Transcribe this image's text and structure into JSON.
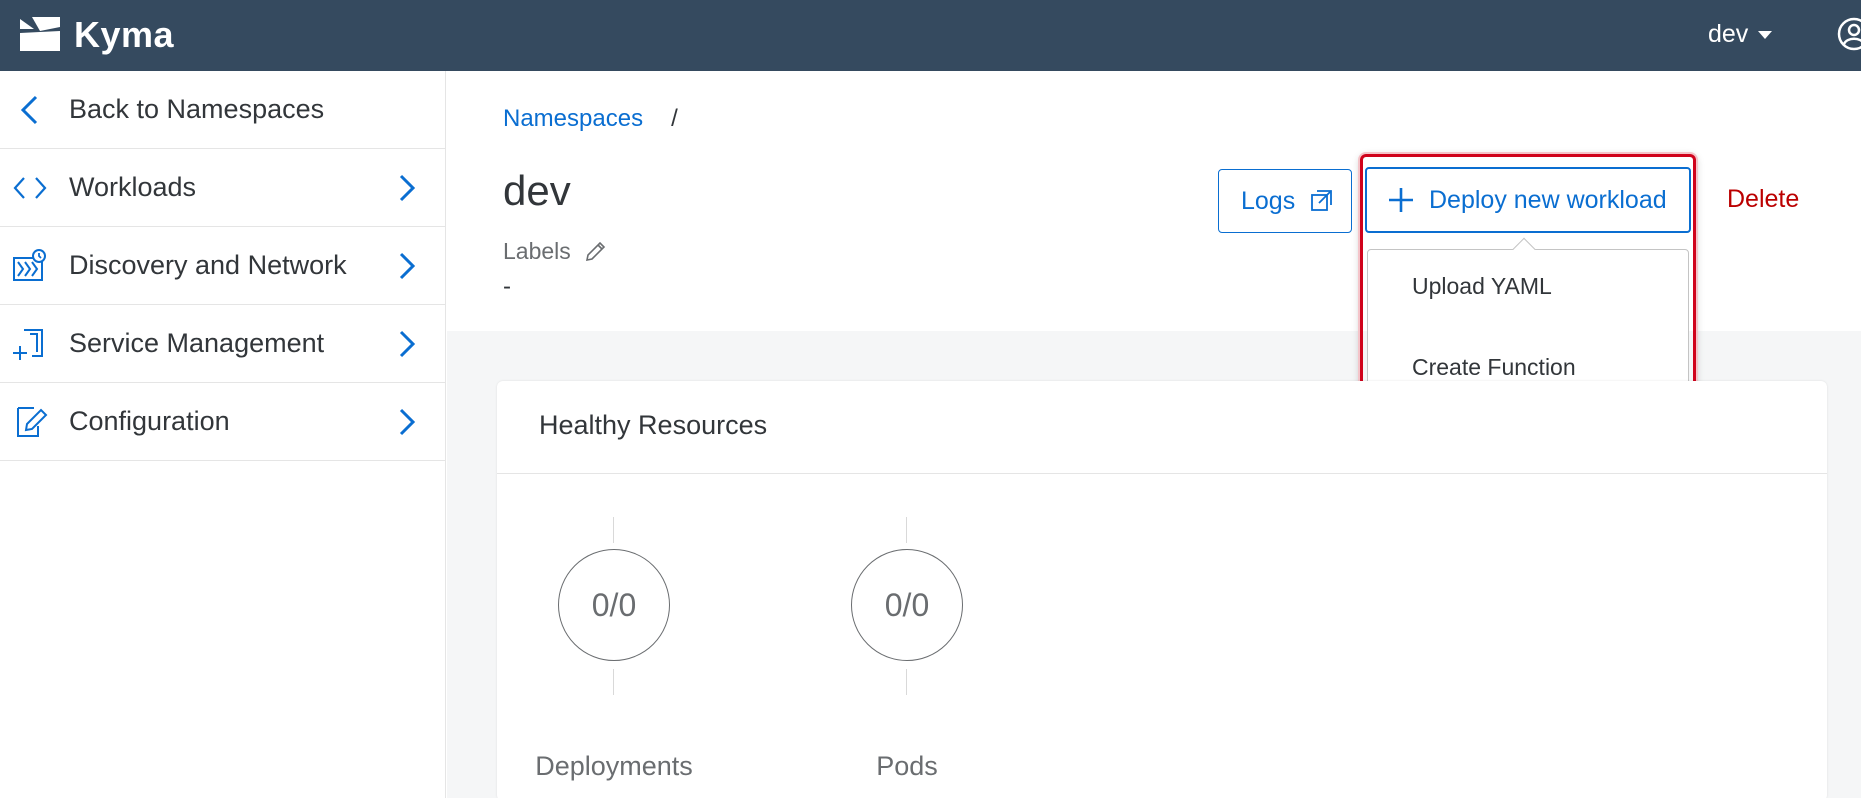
{
  "shellbar": {
    "brand": "Kyma",
    "namespace": "dev"
  },
  "sidebar": {
    "back": "Back to Namespaces",
    "items": [
      {
        "label": "Workloads",
        "icon": "code-brackets-icon"
      },
      {
        "label": "Discovery and Network",
        "icon": "discovery-network-icon"
      },
      {
        "label": "Service Management",
        "icon": "service-management-icon"
      },
      {
        "label": "Configuration",
        "icon": "configuration-icon"
      }
    ]
  },
  "header": {
    "breadcrumb": {
      "link": "Namespaces",
      "separator": "/"
    },
    "title": "dev",
    "labels_label": "Labels",
    "labels_value": "-"
  },
  "actions": {
    "logs": "Logs",
    "deploy": "Deploy new workload",
    "delete": "Delete",
    "deploy_menu": [
      "Upload YAML",
      "Create Function"
    ]
  },
  "card": {
    "title": "Healthy Resources",
    "stats": [
      {
        "value": "0/0",
        "label": "Deployments"
      },
      {
        "value": "0/0",
        "label": "Pods"
      }
    ]
  },
  "colors": {
    "shellbar": "#354a5f",
    "accent": "#0a6ed1",
    "danger": "#bb0000",
    "highlight": "#d0021b"
  }
}
